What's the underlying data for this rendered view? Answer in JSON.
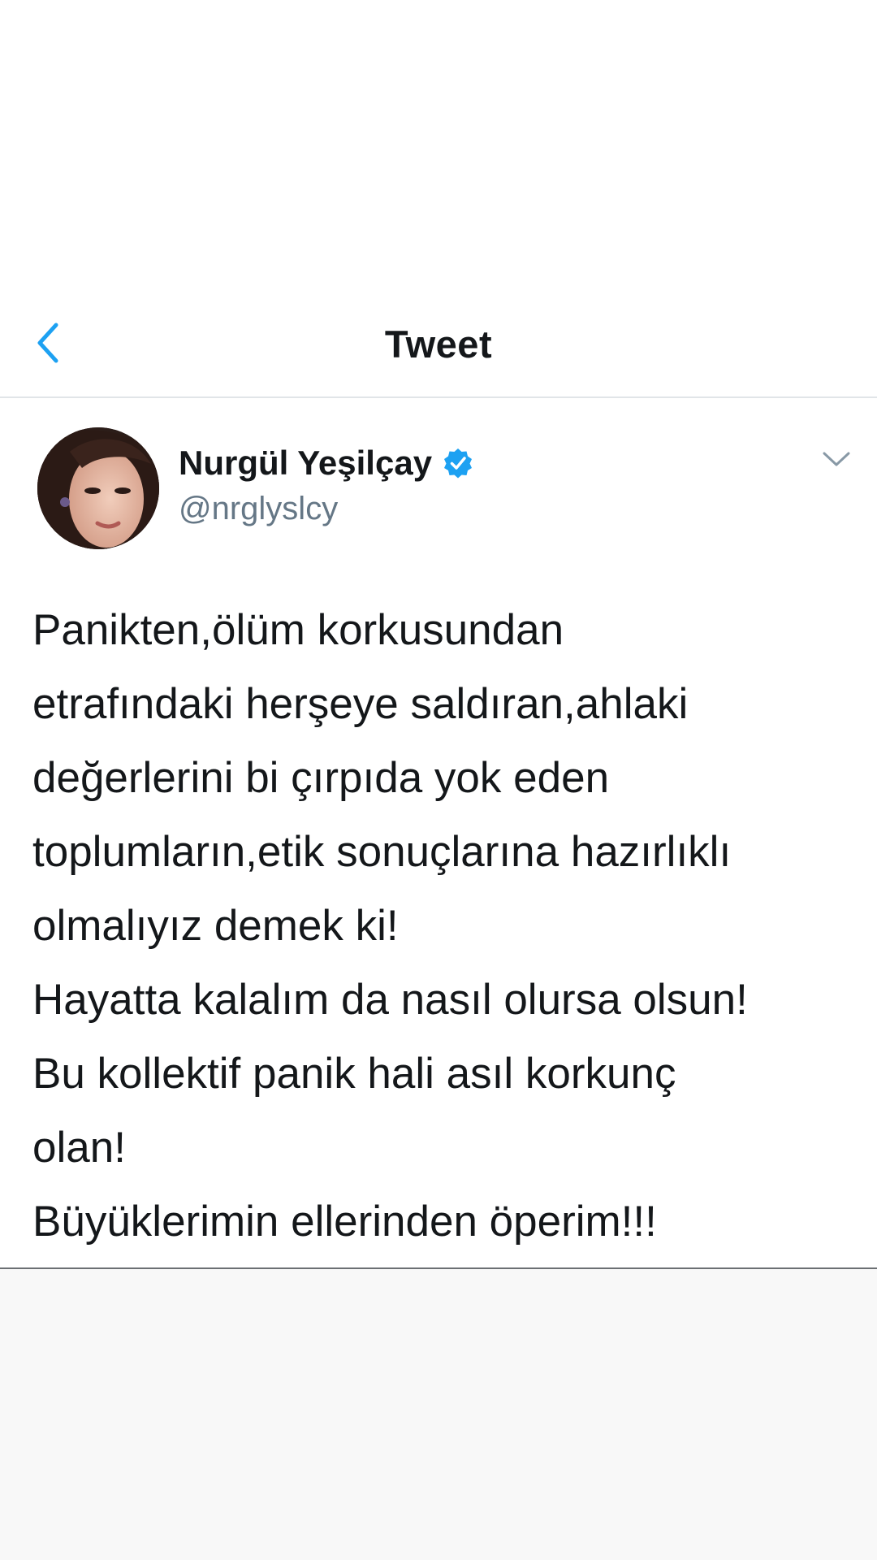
{
  "nav": {
    "title": "Tweet",
    "back_icon": "chevron-left-icon"
  },
  "tweet": {
    "author_name": "Nurgül Yeşilçay",
    "handle": "@nrglyslcy",
    "verified_icon": "verified-badge-icon",
    "more_icon": "chevron-down-icon",
    "text_lines": [
      "Panikten,ölüm korkusundan",
      "etrafındaki herşeye saldıran,ahlaki",
      "değerlerini bi çırpıda yok eden",
      "toplumların,etik sonuçlarına hazırlıklı",
      "olmalıyız demek ki!",
      "Hayatta kalalım da nasıl olursa olsun!",
      "Bu kollektif panik hali asıl korkunç",
      "olan!",
      "Büyüklerimin ellerinden öperim!!!"
    ]
  },
  "colors": {
    "accent": "#1da1f2",
    "text": "#14171a",
    "secondary_text": "#657786"
  }
}
